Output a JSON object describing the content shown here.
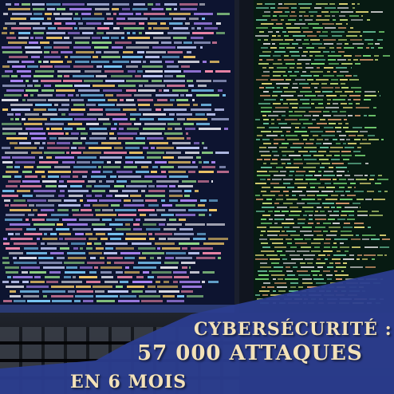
{
  "headline": {
    "line1": "CYBERSÉCURITÉ :",
    "line2": "57 000 ATTAQUES",
    "line3": "EN 6 MOIS"
  },
  "colors": {
    "banner": "#2b3d8f",
    "headline_text": "#f2e1b8",
    "code_left_bg": "#0d1430",
    "code_right_bg": "#071a12"
  }
}
